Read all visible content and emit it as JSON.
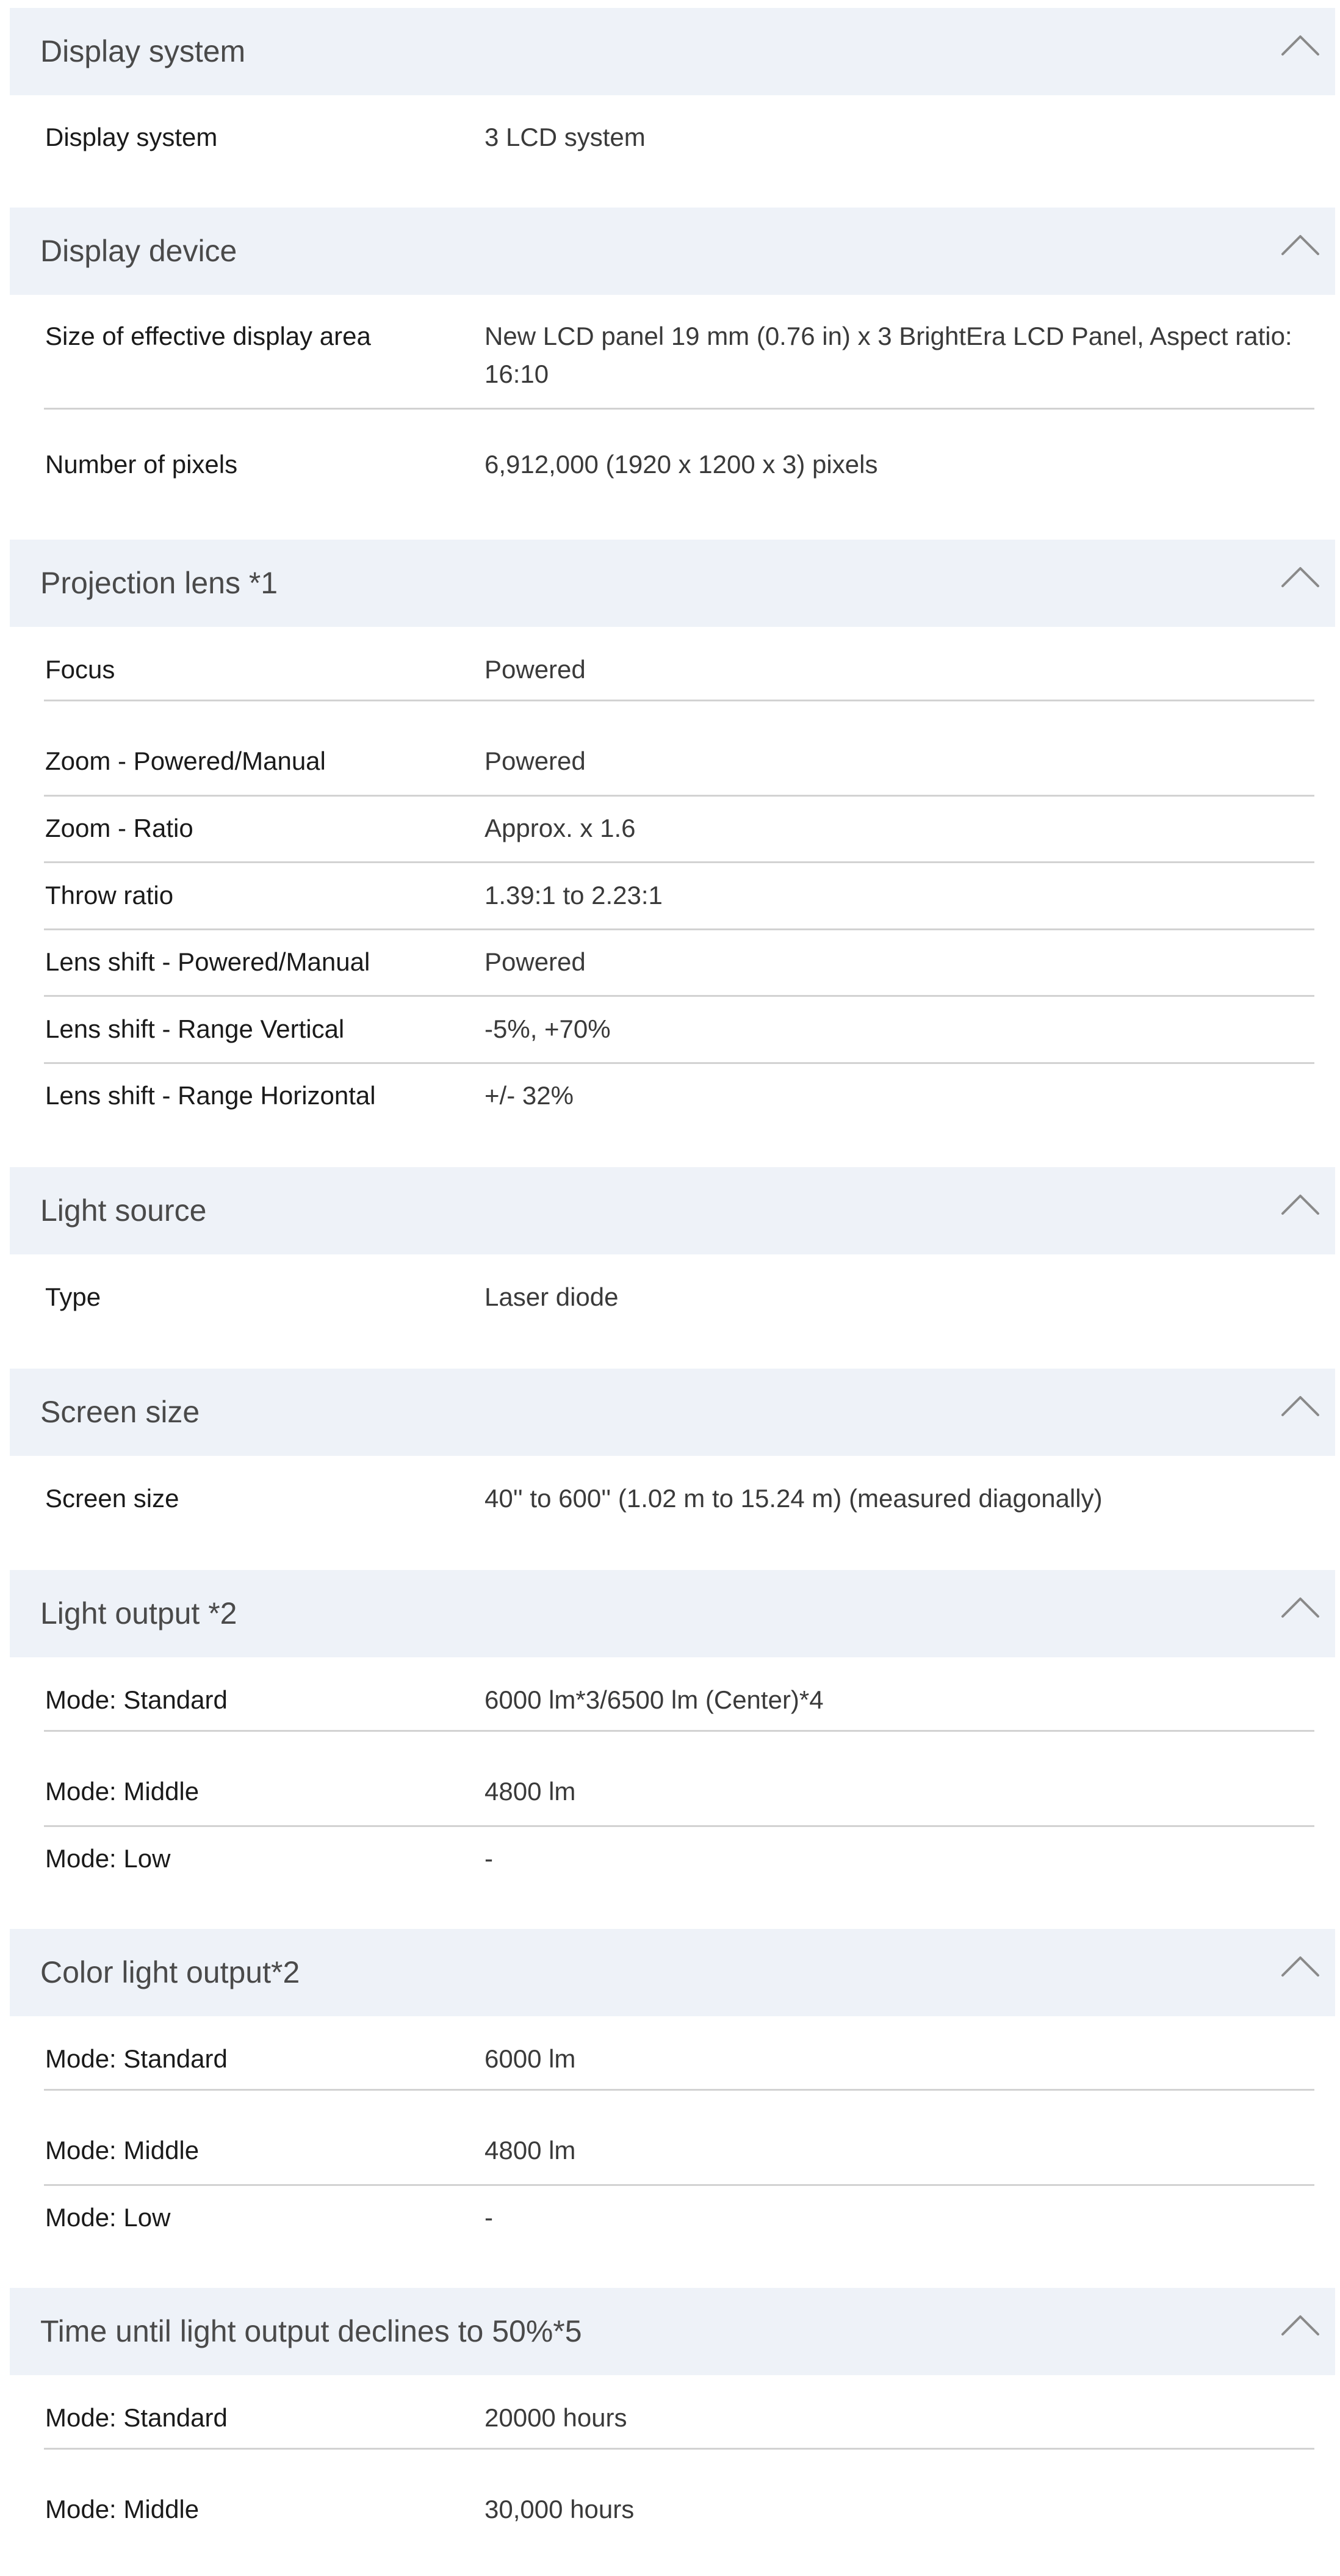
{
  "chevron_color": "#8a8a8a",
  "header_background": "#eef2f8",
  "sections": [
    {
      "title": "Display system",
      "icon": "chevron-up-icon",
      "rows": [
        {
          "label": "Display system",
          "value": "3 LCD system"
        }
      ]
    },
    {
      "title": "Display device",
      "icon": "chevron-up-icon",
      "rows": [
        {
          "label": "Size of effective display area",
          "value": "New LCD panel 19 mm (0.76 in) x 3 BrightEra LCD Panel, Aspect ratio: 16:10"
        },
        {
          "label": "Number of pixels",
          "value": "6,912,000 (1920 x 1200 x 3) pixels"
        }
      ]
    },
    {
      "title": "Projection lens *1",
      "icon": "chevron-up-icon",
      "rows": [
        {
          "label": "Focus",
          "value": "Powered"
        },
        {
          "label": "Zoom - Powered/Manual",
          "value": "Powered"
        },
        {
          "label": "Zoom - Ratio",
          "value": "Approx. x 1.6"
        },
        {
          "label": "Throw ratio",
          "value": "1.39:1 to 2.23:1"
        },
        {
          "label": "Lens shift - Powered/Manual",
          "value": "Powered"
        },
        {
          "label": "Lens shift - Range Vertical",
          "value": "-5%, +70%"
        },
        {
          "label": "Lens shift - Range Horizontal",
          "value": "+/- 32%"
        }
      ]
    },
    {
      "title": "Light source",
      "icon": "chevron-up-icon",
      "rows": [
        {
          "label": "Type",
          "value": "Laser diode"
        }
      ]
    },
    {
      "title": "Screen size",
      "icon": "chevron-up-icon",
      "rows": [
        {
          "label": "Screen size",
          "value": "40'' to 600'' (1.02 m to 15.24 m) (measured diagonally)"
        }
      ]
    },
    {
      "title": "Light output *2",
      "icon": "chevron-up-icon",
      "rows": [
        {
          "label": "Mode: Standard",
          "value": "6000 lm*3/6500 lm (Center)*4"
        },
        {
          "label": "Mode: Middle",
          "value": "4800 lm"
        },
        {
          "label": "Mode: Low",
          "value": "-"
        }
      ]
    },
    {
      "title": "Color light output*2",
      "icon": "chevron-up-icon",
      "rows": [
        {
          "label": "Mode: Standard",
          "value": "6000 lm"
        },
        {
          "label": "Mode: Middle",
          "value": "4800 lm"
        },
        {
          "label": "Mode: Low",
          "value": "-"
        }
      ]
    },
    {
      "title": "Time until light output declines to 50%*5",
      "icon": "chevron-up-icon",
      "rows": [
        {
          "label": "Mode: Standard",
          "value": "20000 hours"
        },
        {
          "label": "Mode: Middle",
          "value": "30,000 hours"
        }
      ]
    }
  ]
}
